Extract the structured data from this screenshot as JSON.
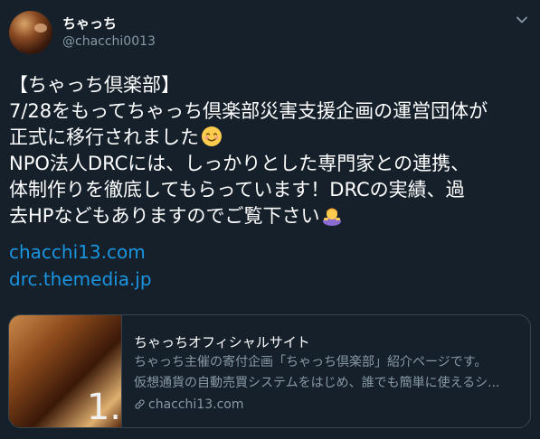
{
  "tweet": {
    "display_name": "ちゃっち",
    "handle": "@chacchi0013",
    "lines": [
      "【ちゃっち倶楽部】",
      "7/28をもってちゃっち倶楽部災害支援企画の運営団体が",
      "正式に移行されました",
      "NPO法人DRCには、しっかりとした専門家との連携、",
      "体制作りを徹底してもらっています！DRCの実績、過",
      "去HPなどもありますのでご覧下さい"
    ],
    "emoji": [
      "smiling-face-icon",
      "person-bowing-icon"
    ],
    "links": [
      "chacchi13.com",
      "drc.themedia.jp"
    ]
  },
  "card": {
    "title": "ちゃっちオフィシャルサイト",
    "description_lines": [
      "ちゃっち主催の寄付企画「ちゃっち倶楽部」紹介ページです。",
      "仮想通貨の自動売買システムをはじめ、誰でも簡単に使えるシ..."
    ],
    "domain": "chacchi13.com",
    "thumb_text": "1."
  },
  "colors": {
    "background": "#15202b",
    "link": "#1b95e0",
    "secondary_text": "#8899a6",
    "border": "#38444d"
  }
}
